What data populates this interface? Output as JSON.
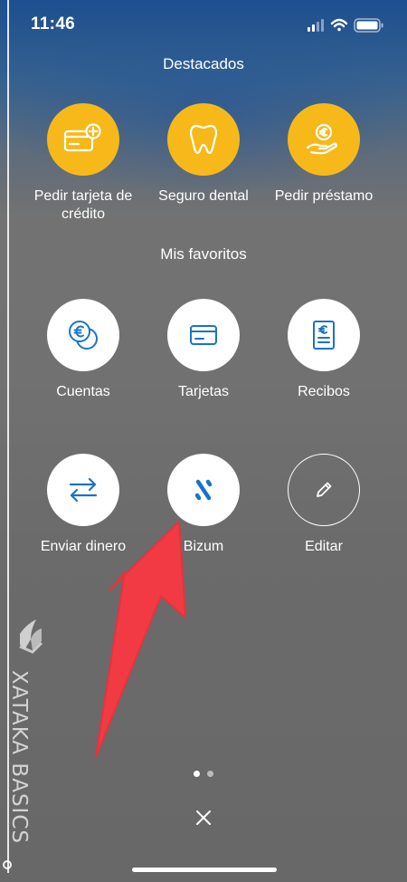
{
  "status_bar": {
    "time": "11:46"
  },
  "highlights": {
    "title": "Destacados",
    "items": [
      {
        "label": "Pedir tarjeta de crédito",
        "icon": "credit-card-add-icon"
      },
      {
        "label": "Seguro dental",
        "icon": "tooth-icon"
      },
      {
        "label": "Pedir préstamo",
        "icon": "hand-euro-coin-icon"
      }
    ]
  },
  "favorites": {
    "title": "Mis favoritos",
    "items": [
      {
        "label": "Cuentas",
        "icon": "euro-coins-icon"
      },
      {
        "label": "Tarjetas",
        "icon": "card-icon"
      },
      {
        "label": "Recibos",
        "icon": "receipt-euro-icon"
      },
      {
        "label": "Enviar dinero",
        "icon": "transfer-arrows-icon"
      },
      {
        "label": "Bizum",
        "icon": "bizum-icon"
      },
      {
        "label": "Editar",
        "icon": "pencil-icon"
      }
    ]
  },
  "watermark": {
    "text": "XATAKA BASICS"
  },
  "pagination": {
    "current": 1,
    "total": 2
  },
  "colors": {
    "accent_yellow": "#f7b919",
    "icon_blue": "#1a73c8",
    "arrow_red": "#f23a45"
  }
}
